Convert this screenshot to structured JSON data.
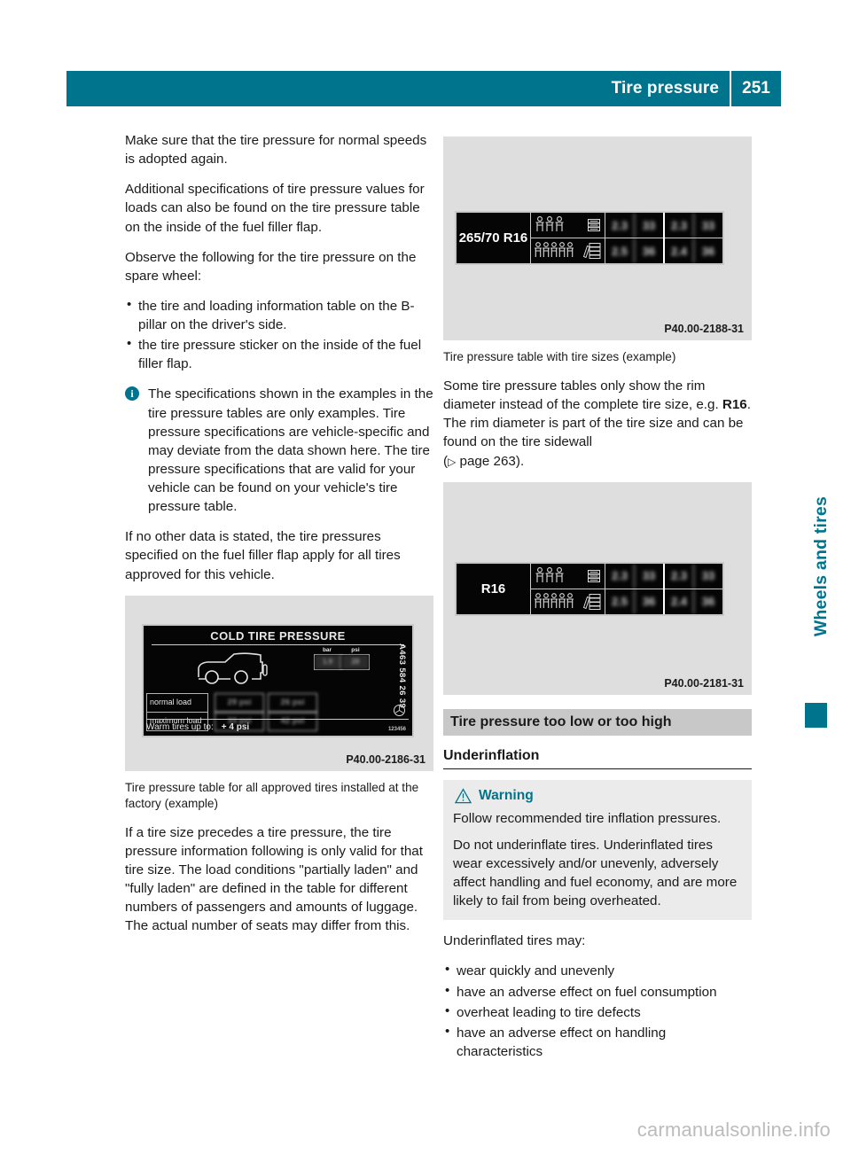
{
  "colors": {
    "teal": "#00748d",
    "figure_bg": "#dedede",
    "section_bar": "#c8c8c8",
    "warning_bg": "#ebebeb",
    "watermark": "#bcbcbc"
  },
  "header": {
    "title": "Tire pressure",
    "page": "251"
  },
  "left_column": {
    "paragraph_1": "Make sure that the tire pressure for normal speeds is adopted again.",
    "paragraph_2": "Additional specifications of tire pressure values for loads can also be found on the tire pressure table on the inside of the fuel filler flap.",
    "paragraph_3": "Observe the following for the tire pressure on the spare wheel:",
    "bullets": [
      "the tire and loading information table on the B-pillar on the driver's side.",
      "the tire pressure sticker on the inside of the fuel filler flap."
    ],
    "note_icon": "info-icon",
    "note": "The specifications shown in the examples in the tire pressure tables are only examples. Tire pressure specifications are vehicle-specific and may deviate from the data shown here. The tire pressure specifications that are valid for your vehicle can be found on your vehicle's tire pressure table.",
    "paragraph_4": "If no other data is stated, the tire pressures specified on the fuel filler flap apply for all tires approved for this vehicle.",
    "figure_sticker": {
      "code": "P40.00-2186-31",
      "title": "COLD TIRE PRESSURE",
      "unit_headers": [
        "bar",
        "psi"
      ],
      "unit_values": [
        "1.9",
        "28"
      ],
      "rows": [
        {
          "label": "normal load",
          "values": [
            "29 psi",
            "26 psi"
          ]
        },
        {
          "label": "maximum load",
          "values": [
            "33 psi",
            "42 psi"
          ]
        }
      ],
      "warm_label": "Warm tires up to:",
      "warm_value": "+ 4 psi",
      "part_number": "A463 584 26 39",
      "serial": "123456",
      "caption": "Tire pressure table for all approved tires installed at the factory (example)"
    },
    "paragraph_5": "If a tire size precedes a tire pressure, the tire pressure information following is only valid for that tire size. The load conditions \"partially laden\" and \"fully laden\" are defined in the table for different numbers of passengers and amounts of luggage. The actual number of seats may differ from this."
  },
  "right_column": {
    "figure_tire_size": {
      "code": "P40.00-2188-31",
      "size_label": "265/70 R16",
      "rows": [
        {
          "occupants": 3,
          "luggage": "luggage-stack-icon",
          "group_a": [
            "2.3",
            "33"
          ],
          "group_b": [
            "2.3",
            "33"
          ]
        },
        {
          "occupants": 5,
          "luggage": "luggage-suitcase-icon",
          "group_a": [
            "2.5",
            "36"
          ],
          "group_b": [
            "2.4",
            "36"
          ]
        }
      ],
      "caption": "Tire pressure table with tire sizes (example)"
    },
    "paragraph_1_pre": "Some tire pressure tables only show the rim diameter instead of the complete tire size, e.g. ",
    "paragraph_1_bold": "R16",
    "paragraph_1_post": ". The rim diameter is part of the tire size and can be found on the tire sidewall",
    "cross_ref_arrow": "▷",
    "cross_ref_text": "page 263",
    "figure_rim": {
      "code": "P40.00-2181-31",
      "size_label": "R16",
      "rows": [
        {
          "occupants": 3,
          "luggage": "luggage-stack-icon",
          "group_a": [
            "2.3",
            "33"
          ],
          "group_b": [
            "2.3",
            "33"
          ]
        },
        {
          "occupants": 5,
          "luggage": "luggage-suitcase-icon",
          "group_a": [
            "2.5",
            "36"
          ],
          "group_b": [
            "2.4",
            "36"
          ]
        }
      ]
    },
    "section_title": "Tire pressure too low or too high",
    "sub_title": "Underinflation",
    "warning": {
      "icon": "warning-triangle-icon",
      "title": "Warning",
      "line_1": "Follow recommended tire inflation pressures.",
      "line_2": "Do not underinflate tires. Underinflated tires wear excessively and/or unevenly, adversely affect handling and fuel economy, and are more likely to fail from being overheated."
    },
    "list_intro": "Underinflated tires may:",
    "bullets": [
      "wear quickly and unevenly",
      "have an adverse effect on fuel consumption",
      "overheat leading to tire defects",
      "have an adverse effect on handling characteristics"
    ]
  },
  "side_tab": {
    "label": "Wheels and tires"
  },
  "watermark": {
    "text": "carmanualsonline.info"
  }
}
